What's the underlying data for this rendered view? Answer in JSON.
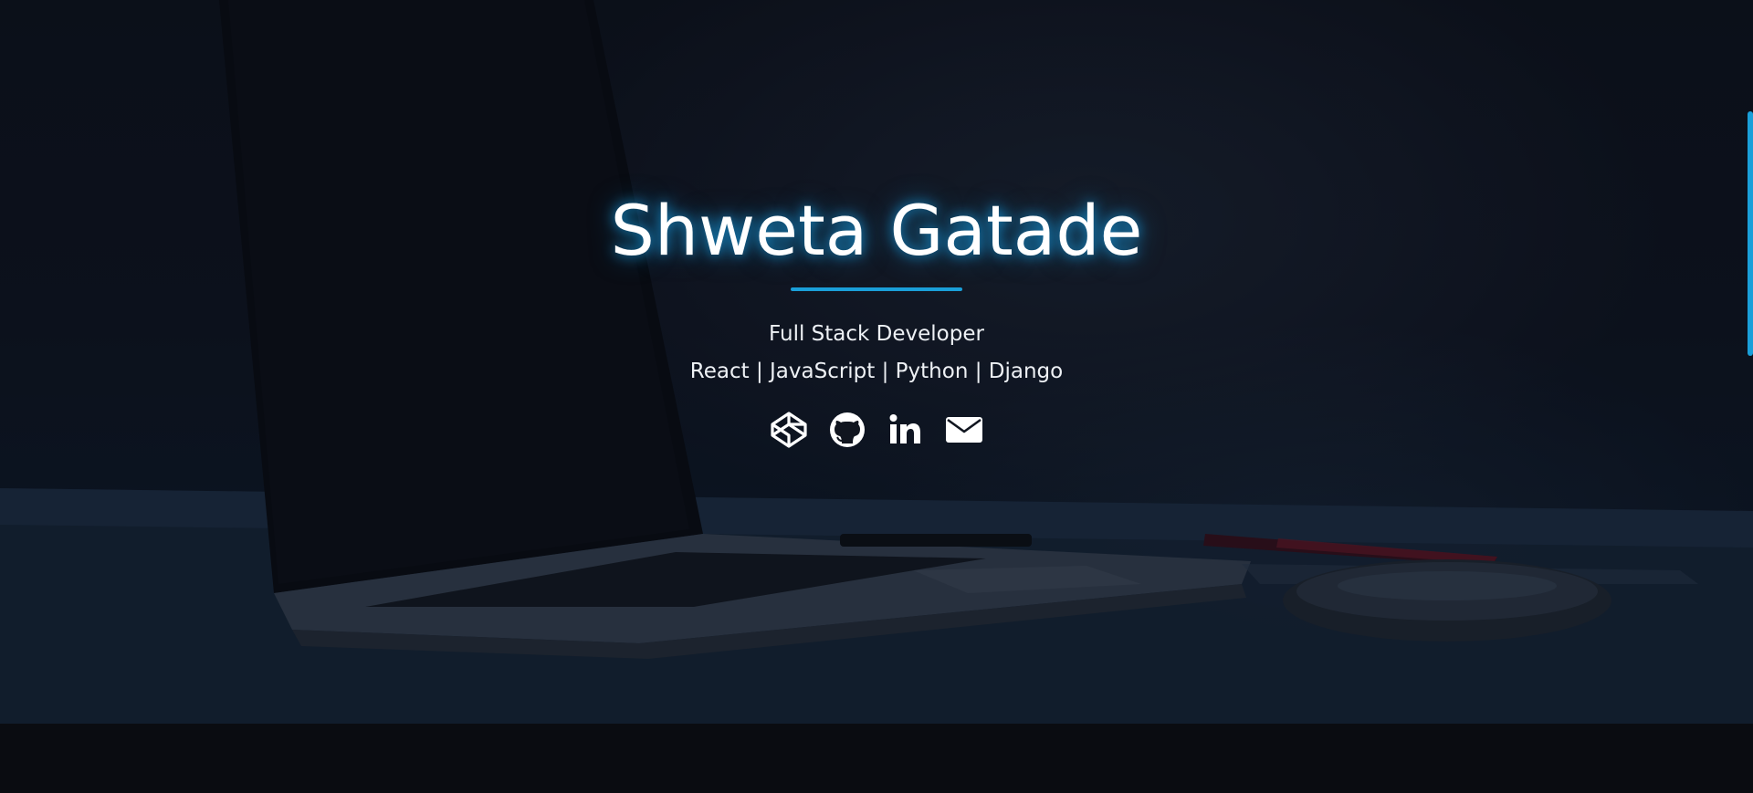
{
  "hero": {
    "name": "Shweta Gatade",
    "role": "Full Stack Developer",
    "skills": "React | JavaScript | Python | Django",
    "accent_color": "#1a9fd9"
  },
  "socials": [
    {
      "icon": "codepen-icon"
    },
    {
      "icon": "github-icon"
    },
    {
      "icon": "linkedin-icon"
    },
    {
      "icon": "email-icon"
    }
  ]
}
